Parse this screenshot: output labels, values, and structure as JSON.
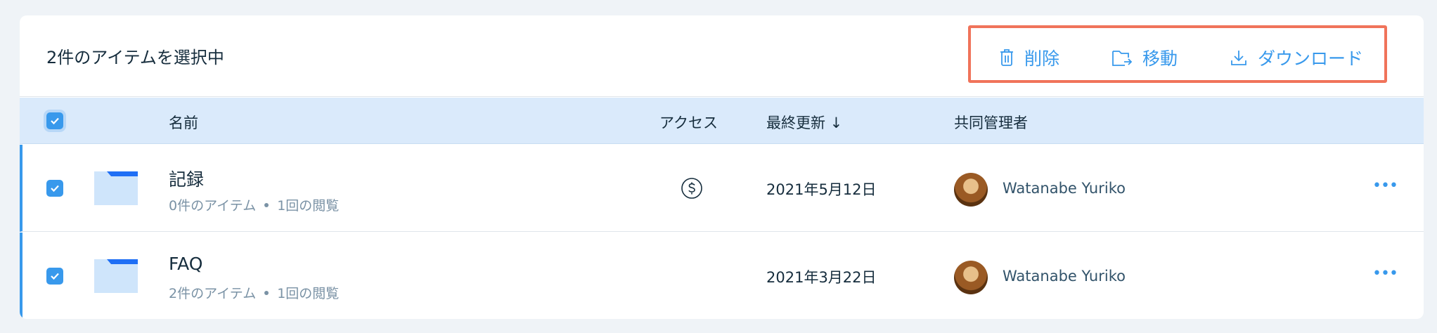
{
  "toolbar": {
    "selected_count": "2件のアイテムを選択中",
    "actions": {
      "delete": "削除",
      "move": "移動",
      "download": "ダウンロード"
    }
  },
  "table": {
    "columns": {
      "name": "名前",
      "access": "アクセス",
      "modified": "最終更新 ↓",
      "coadmin": "共同管理者"
    },
    "rows": [
      {
        "name": "記録",
        "item_count": "0件のアイテム",
        "views": "1回の閲覧",
        "access_icon": "dollar-circle-icon",
        "modified": "2021年5月12日",
        "coadmin": "Watanabe Yuriko",
        "checked": true
      },
      {
        "name": "FAQ",
        "item_count": "2件のアイテム",
        "views": "1回の閲覧",
        "access_icon": "",
        "modified": "2021年3月22日",
        "coadmin": "Watanabe Yuriko",
        "checked": true
      }
    ]
  },
  "colors": {
    "accent": "#3899ec",
    "highlight_border": "#f0735a",
    "header_bg": "#daeafb",
    "folder_light": "#cfe5fb",
    "folder_dark": "#1f6ff5"
  }
}
